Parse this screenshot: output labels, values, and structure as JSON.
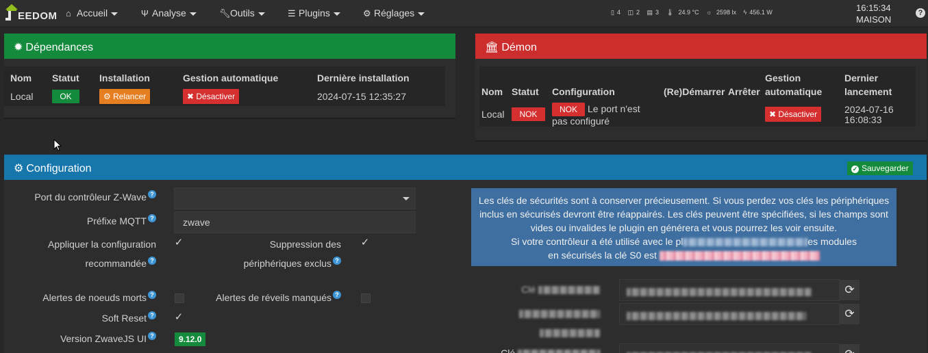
{
  "navbar": {
    "logo_text": "EEDOM",
    "menu": [
      {
        "label": "Accueil",
        "icon": "home-icon"
      },
      {
        "label": "Analyse",
        "icon": "analysis-icon"
      },
      {
        "label": "Outils",
        "icon": "wrench-icon"
      },
      {
        "label": "Plugins",
        "icon": "list-icon"
      },
      {
        "label": "Réglages",
        "icon": "gear-icon"
      }
    ],
    "status": {
      "doors": "4",
      "windows": "2",
      "shutters": "3",
      "temperature": "24.9 °C",
      "luminosity": "2598 lx",
      "power": "456.1 W"
    },
    "time": "16:15:34",
    "location": "MAISON"
  },
  "dependances": {
    "title": "Dépendances",
    "headers": [
      "Nom",
      "Statut",
      "Installation",
      "Gestion automatique",
      "Dernière installation"
    ],
    "row": {
      "name": "Local",
      "status": "OK",
      "install_button": "Relancer",
      "auto_button": "Désactiver",
      "last_install": "2024-07-15 12:35:27"
    }
  },
  "demon": {
    "title": "Démon",
    "headers": {
      "name": "Nom",
      "status": "Statut",
      "config": "Configuration",
      "restart": "(Re)Démarrer",
      "stop": "Arrêter",
      "auto_1": "Gestion",
      "auto_2": "automatique",
      "last_1": "Dernier",
      "last_2": "lancement"
    },
    "row": {
      "name": "Local",
      "status": "NOK",
      "config_badge": "NOK",
      "config_msg_1": "Le port n'est",
      "config_msg_2": "pas configuré",
      "auto_button": "Désactiver",
      "last_date": "2024-07-16",
      "last_time": "16:08:33"
    }
  },
  "configuration": {
    "title": "Configuration",
    "save_label": "Sauvegarder",
    "port_label": "Port du contrôleur Z-Wave",
    "port_value": "",
    "mqtt_label": "Préfixe MQTT",
    "mqtt_value": "zwave",
    "apply_label_1": "Appliquer la configuration",
    "apply_label_2": "recommandée",
    "suppress_label_1": "Suppression des",
    "suppress_label_2": "périphériques exclus",
    "dead_nodes_label": "Alertes de noeuds morts",
    "missed_wakeup_label": "Alertes de réveils manqués",
    "soft_reset_label": "Soft Reset",
    "version_label": "Version ZwaveJS UI",
    "version_value": "9.12.0",
    "apply_checked": true,
    "suppress_checked": true,
    "dead_nodes_checked": false,
    "missed_wakeup_checked": false,
    "soft_reset_checked": true,
    "info_line1": "Les clés de sécurités sont à conserver précieusement. Si vous perdez vos clés les périphériques",
    "info_line2": "inclus en sécurisés devront être réappairés. Les clés peuvent être spécifiées, si les champs sont",
    "info_line3": "vides ou invalides le plugin en générera et vous pourrez les voir ensuite.",
    "info_line4_start": "Si votre contrôleur a été utilisé avec le pl",
    "info_line4_end": "es modules",
    "info_line5_start": "en sécurisés la clé S0 est",
    "key_s0_label_prefix": "Clé",
    "key_s2_label_prefix": "Clé"
  }
}
